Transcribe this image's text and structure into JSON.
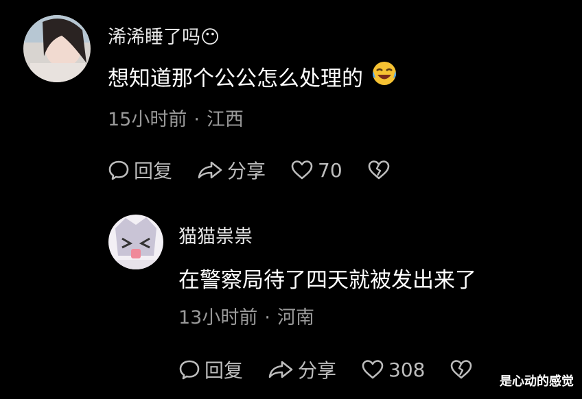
{
  "comments": [
    {
      "username": "浠浠睡了吗😶",
      "text": "想知道那个公公怎么处理的",
      "emoji": "laughing-crying-emoji",
      "time": "15小时前",
      "location": "江西",
      "reply_label": "回复",
      "share_label": "分享",
      "likes": "70"
    },
    {
      "username": "猫猫祟祟",
      "text": "在警察局待了四天就被发出来了",
      "time": "13小时前",
      "location": "河南",
      "reply_label": "回复",
      "share_label": "分享",
      "likes": "308"
    }
  ],
  "watermark": "是心动的感觉",
  "colors": {
    "background": "#000000",
    "meta_text": "#9a9a9a",
    "action_text": "#bdbdbd"
  }
}
